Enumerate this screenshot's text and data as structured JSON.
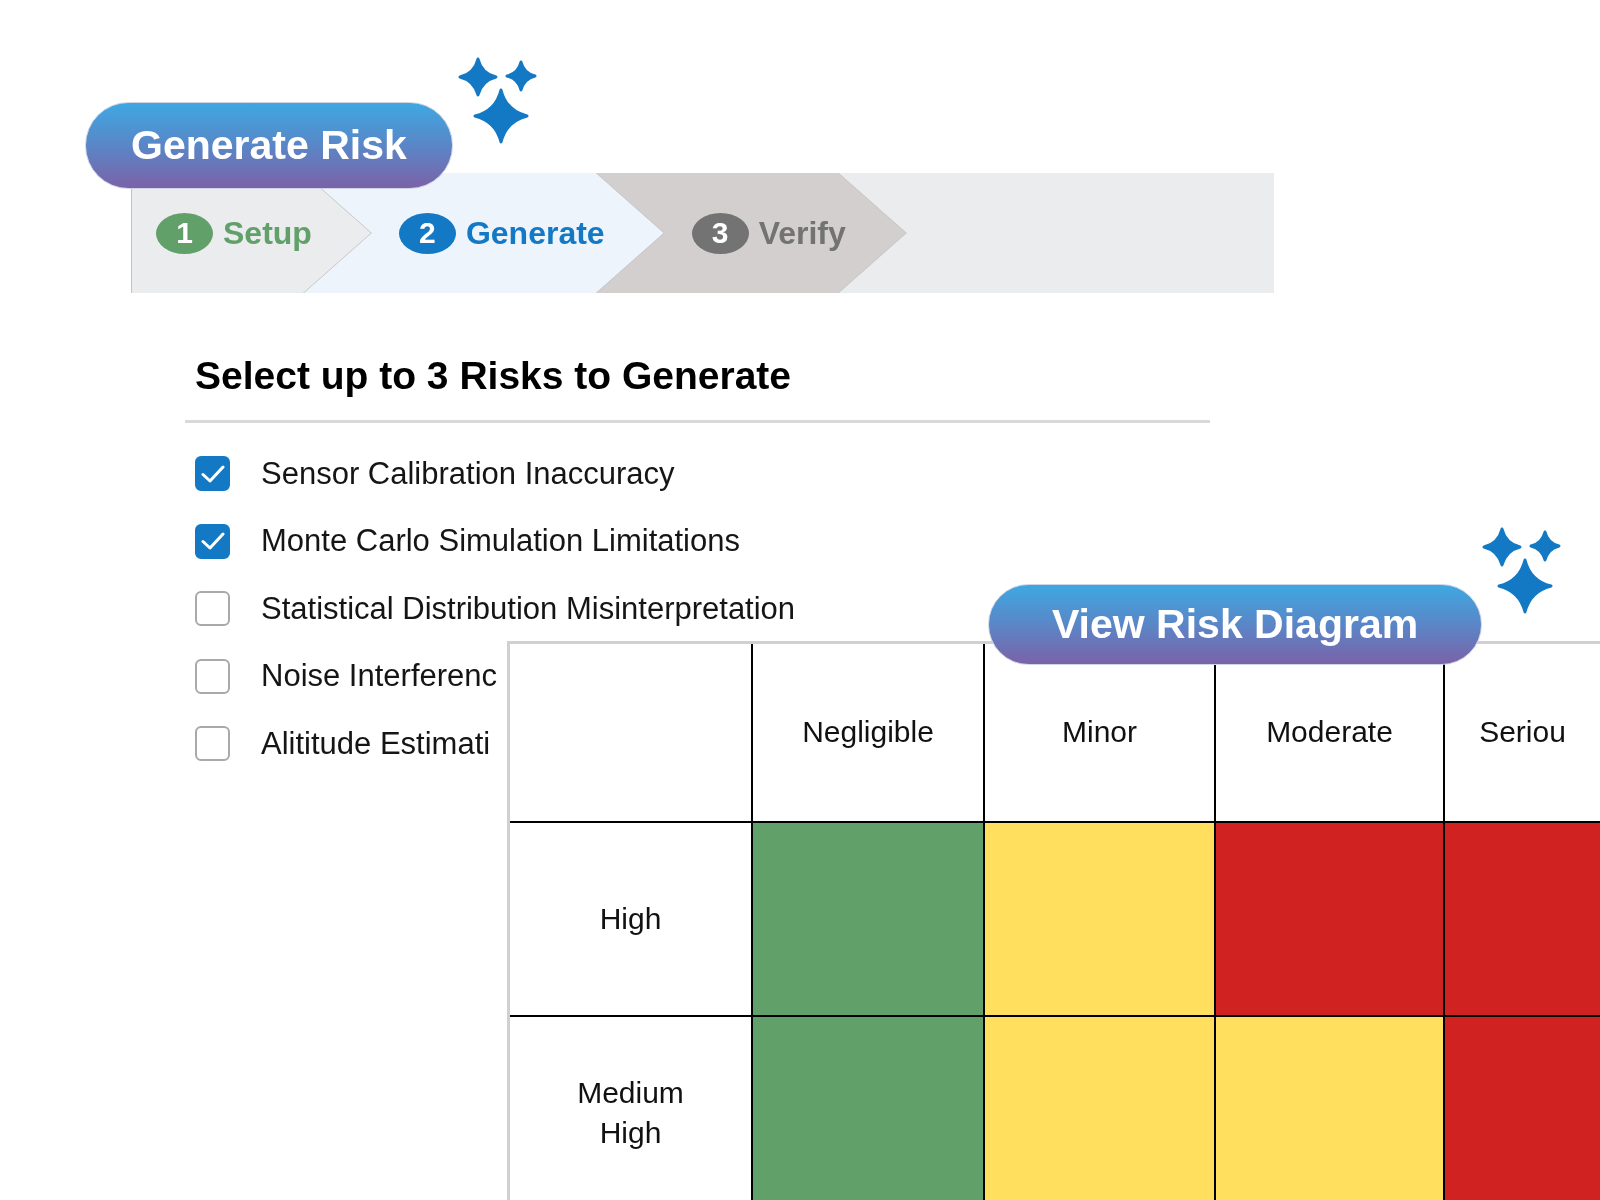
{
  "header": {
    "button": "Generate Risk"
  },
  "steps": [
    {
      "number": "1",
      "label": "Setup",
      "completed": true,
      "selected": false
    },
    {
      "number": "2",
      "label": "Generate",
      "completed": false,
      "selected": true
    },
    {
      "number": "3",
      "label": "Verify",
      "completed": false,
      "selected": false
    }
  ],
  "risk_selection": {
    "title": "Select up to 3 Risks to Generate",
    "items": [
      {
        "label": "Sensor Calibration Inaccuracy",
        "checked": true
      },
      {
        "label": "Monte Carlo Simulation Limitations",
        "checked": true
      },
      {
        "label": "Statistical Distribution Misinterpretation",
        "checked": false
      },
      {
        "label": "Noise Interferenc",
        "checked": false
      },
      {
        "label": "Alititude Estimati",
        "checked": false
      }
    ]
  },
  "risk_diagram": {
    "button": "View Risk Diagram",
    "columns": [
      "Negligible",
      "Minor",
      "Moderate",
      "Seriou"
    ],
    "rows": [
      {
        "label": "High",
        "cells": [
          {
            "color": "#62a06a"
          },
          {
            "color": "#ffdf5d"
          },
          {
            "color": "#d12222"
          },
          {
            "color": "#d12222"
          }
        ]
      },
      {
        "label": "Medium High",
        "cells": [
          {
            "color": "#62a06a"
          },
          {
            "color": "#ffdf5d"
          },
          {
            "color": "#ffdf5d"
          },
          {
            "color": "#d12222"
          }
        ]
      }
    ]
  }
}
